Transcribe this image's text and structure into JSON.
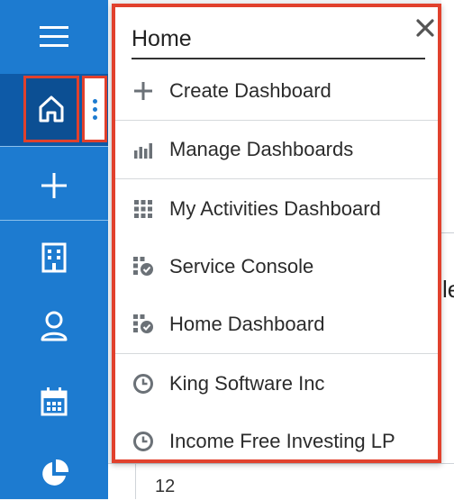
{
  "nav": {
    "icons": [
      "hamburger-icon",
      "home-icon",
      "more-vertical-icon",
      "plus-icon",
      "accounts-icon",
      "contacts-icon",
      "calendar-icon",
      "reports-icon"
    ]
  },
  "background": {
    "partial_letter": "le",
    "row_number": "12"
  },
  "dropdown": {
    "title": "Home",
    "close_symbol": "✕",
    "items": [
      {
        "label": "Create Dashboard",
        "icon": "plus-icon"
      },
      {
        "label": "Manage Dashboards",
        "icon": "bar-chart-icon"
      },
      {
        "label": "My Activities Dashboard",
        "icon": "grid-icon"
      },
      {
        "label": "Service Console",
        "icon": "grid-check-icon"
      },
      {
        "label": "Home Dashboard",
        "icon": "grid-check-icon"
      },
      {
        "label": "King Software Inc",
        "icon": "clock-icon"
      },
      {
        "label": "Income Free Investing LP",
        "icon": "clock-icon"
      }
    ]
  },
  "colors": {
    "nav_bg": "#1d7bd0",
    "nav_active": "#0c4f93",
    "highlight_border": "#e1412d",
    "icon_gray": "#6b7177"
  }
}
